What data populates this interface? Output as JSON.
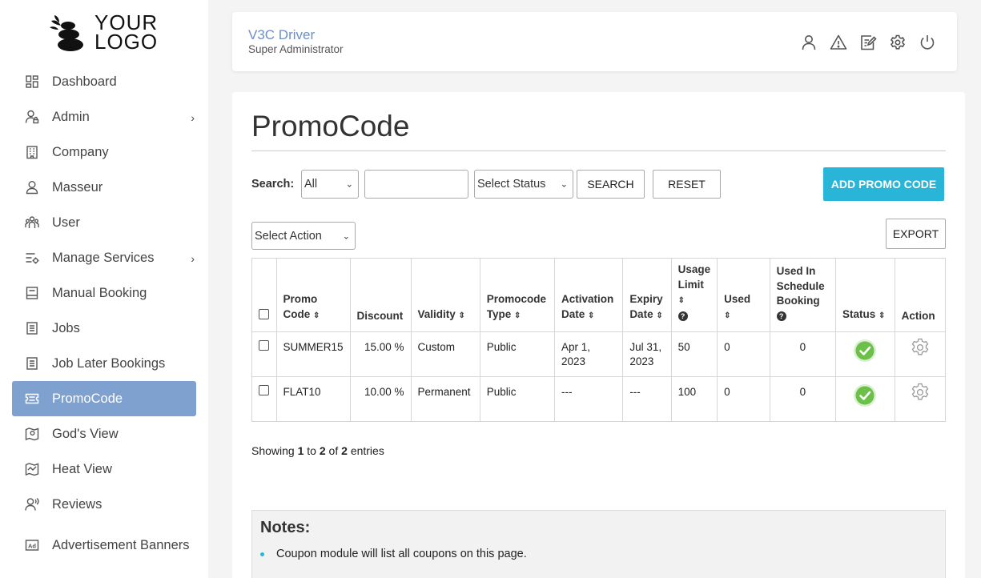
{
  "logo": {
    "line1": "YOUR",
    "line2": "LOGO"
  },
  "sidebar": {
    "items": [
      {
        "label": "Dashboard",
        "icon": "dashboard-icon",
        "has_submenu": false,
        "active": false
      },
      {
        "label": "Admin",
        "icon": "user-lock-icon",
        "has_submenu": true,
        "active": false
      },
      {
        "label": "Company",
        "icon": "building-icon",
        "has_submenu": false,
        "active": false
      },
      {
        "label": "Masseur",
        "icon": "person-icon",
        "has_submenu": false,
        "active": false
      },
      {
        "label": "User",
        "icon": "users-icon",
        "has_submenu": false,
        "active": false
      },
      {
        "label": "Manage Services",
        "icon": "services-icon",
        "has_submenu": true,
        "active": false
      },
      {
        "label": "Manual Booking",
        "icon": "booking-icon",
        "has_submenu": false,
        "active": false
      },
      {
        "label": "Jobs",
        "icon": "document-icon",
        "has_submenu": false,
        "active": false
      },
      {
        "label": "Job Later Bookings",
        "icon": "document-icon",
        "has_submenu": false,
        "active": false
      },
      {
        "label": "PromoCode",
        "icon": "ticket-icon",
        "has_submenu": false,
        "active": true
      },
      {
        "label": "God's View",
        "icon": "map-view-icon",
        "has_submenu": false,
        "active": false
      },
      {
        "label": "Heat View",
        "icon": "heat-map-icon",
        "has_submenu": false,
        "active": false
      },
      {
        "label": "Reviews",
        "icon": "reviews-icon",
        "has_submenu": false,
        "active": false
      },
      {
        "label": "Advertisement Banners",
        "icon": "ad-icon",
        "has_submenu": false,
        "active": false
      }
    ]
  },
  "header": {
    "name": "V3C Driver",
    "role": "Super Administrator",
    "icons": [
      "profile-icon",
      "alert-icon",
      "edit-icon",
      "settings-icon",
      "power-icon"
    ]
  },
  "page": {
    "title": "PromoCode",
    "search_label": "Search:",
    "search_field_select": "All",
    "search_input_value": "",
    "status_select": "Select Status",
    "search_button": "SEARCH",
    "reset_button": "RESET",
    "add_button": "ADD PROMO CODE",
    "action_select": "Select Action",
    "export_button": "EXPORT"
  },
  "table": {
    "headers": {
      "promo_code": [
        "Promo",
        "Code"
      ],
      "discount": "Discount",
      "validity": "Validity",
      "promocode_type": [
        "Promocode",
        "Type"
      ],
      "activation_date": [
        "Activation",
        "Date"
      ],
      "expiry_date": [
        "Expiry",
        "Date"
      ],
      "usage_limit": [
        "Usage",
        "Limit"
      ],
      "used": "Used",
      "used_in_schedule": [
        "Used In",
        "Schedule",
        "Booking"
      ],
      "status": "Status",
      "action": "Action"
    },
    "rows": [
      {
        "code": "SUMMER15",
        "discount": "15.00 %",
        "validity": "Custom",
        "type": "Public",
        "activation": "Apr 1, 2023",
        "expiry": "Jul 31, 2023",
        "usage_limit": "50",
        "used": "0",
        "used_schedule": "0",
        "status": "active"
      },
      {
        "code": "FLAT10",
        "discount": "10.00 %",
        "validity": "Permanent",
        "type": "Public",
        "activation": "---",
        "expiry": "---",
        "usage_limit": "100",
        "used": "0",
        "used_schedule": "0",
        "status": "active"
      }
    ]
  },
  "pagination": {
    "prefix": "Showing",
    "from": "1",
    "to_word": "to",
    "to": "2",
    "of_word": "of",
    "total": "2",
    "suffix": "entries"
  },
  "notes": {
    "title": "Notes:",
    "items": [
      "Coupon module will list all coupons on this page."
    ]
  },
  "colors": {
    "accent": "#29b5d8",
    "active_nav": "#7ea1d0",
    "header_name": "#6c8fc7",
    "status_ok": "#6cc04a"
  }
}
